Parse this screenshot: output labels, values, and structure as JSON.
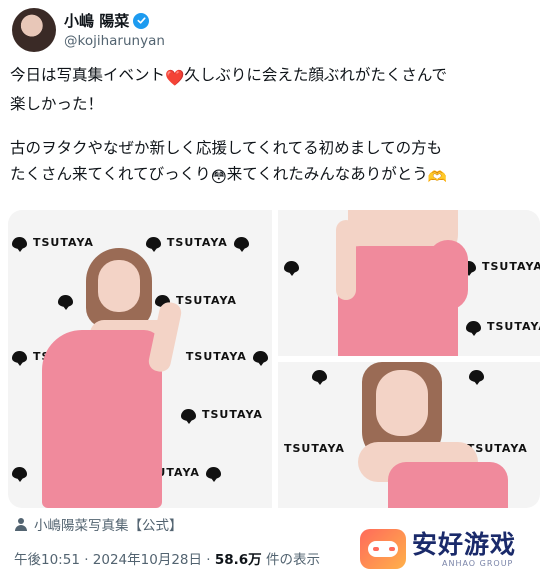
{
  "author": {
    "display_name": "小嶋 陽菜",
    "handle": "@kojiharunyan",
    "verified_icon": "verified-badge-icon",
    "avatar_icon": "avatar"
  },
  "tweet": {
    "paragraph_1_a": "今日は写真集イベント",
    "paragraph_1_emoji": "❤️",
    "paragraph_1_b": "久しぶりに会えた顔ぶれがたくさんで\n楽しかった！",
    "paragraph_2_a": "古のヲタクやなぜか新しく応援してくれてる初めましての方も\nたくさん来てくれてびっくり",
    "paragraph_2_emoji_1": "😳",
    "paragraph_2_b": "来てくれたみんなありがとう",
    "paragraph_2_emoji_2": "🫶"
  },
  "media": {
    "backdrop_logo": "TSUTAYA",
    "photo_count": 3
  },
  "caption": {
    "icon": "person-icon",
    "text": "小嶋陽菜写真集【公式】"
  },
  "meta": {
    "time": "午後10:51",
    "separator": " · ",
    "date": "2024年10月28日",
    "views_value": "58.6万",
    "views_label": " 件の表示"
  },
  "watermark": {
    "cn": "安好游戏",
    "en": "ANHAO GROUP"
  },
  "colors": {
    "accent": "#1d9bf0",
    "secondary_text": "#536471",
    "dress": "#f08a9c"
  }
}
